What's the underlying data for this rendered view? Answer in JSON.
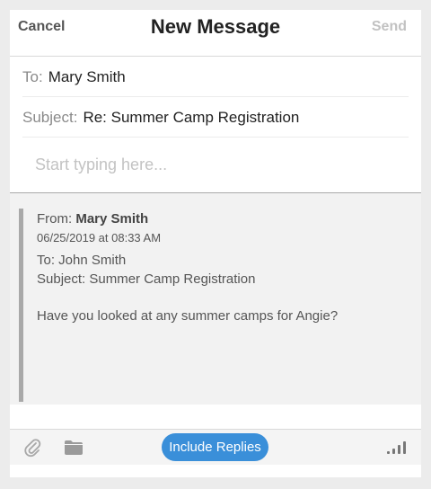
{
  "nav": {
    "cancel_label": "Cancel",
    "title": "New Message",
    "send_label": "Send"
  },
  "compose": {
    "to_label": "To:",
    "to_value": "Mary Smith",
    "subject_label": "Subject:",
    "subject_value": "Re: Summer Camp Registration",
    "body_placeholder": "Start typing here..."
  },
  "quoted": {
    "from_label": "From:",
    "from_name": "Mary Smith",
    "date": "06/25/2019 at 08:33 AM",
    "to_line": "To: John Smith",
    "subject_line": "Subject: Summer Camp Registration",
    "message": "Have you looked at any summer camps for Angie?"
  },
  "toolbar": {
    "attach_icon": "paperclip-icon",
    "folder_icon": "folder-icon",
    "include_replies_label": "Include Replies",
    "signal_icon": "signal-icon",
    "accent_color": "#3a8fd9"
  }
}
